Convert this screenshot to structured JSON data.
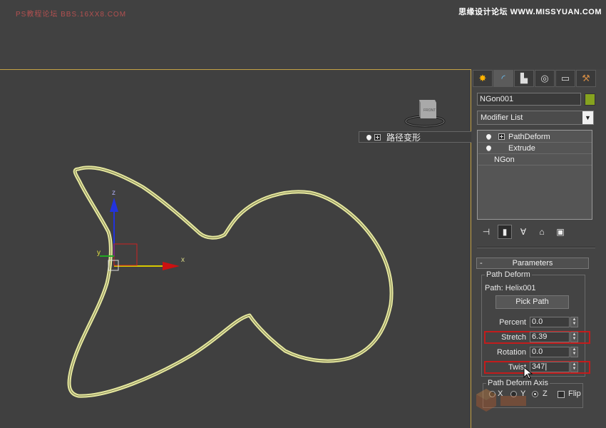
{
  "watermark": {
    "top_left": "PS教程论坛 BBS.16XX8.COM",
    "top_right": "思缘设计论坛 WWW.MISSYUAN.COM"
  },
  "viewport": {
    "viewcube_label": "FRONT",
    "axis_x": "x",
    "axis_y": "y",
    "axis_z": "z",
    "popup_label": "路径变形"
  },
  "command_panel": {
    "tabs": [
      "create-icon",
      "modify-icon",
      "hierarchy-icon",
      "motion-icon",
      "display-icon",
      "utilities-icon"
    ],
    "active_tab": "modify-icon",
    "object_name": "NGon001",
    "object_color": "#86a31f",
    "modifier_list_label": "Modifier List",
    "stack": [
      {
        "label": "PathDeform",
        "bulb": true,
        "expander": true
      },
      {
        "label": "Extrude",
        "bulb": true,
        "expander": false
      },
      {
        "label": "NGon",
        "bulb": false,
        "expander": false
      }
    ]
  },
  "parameters": {
    "rollout_toggle": "-",
    "rollout_title": "Parameters",
    "group_title": "Path Deform",
    "path_label": "Path: Helix001",
    "pick_path_label": "Pick Path",
    "fields": [
      {
        "label": "Percent",
        "value": "0.0",
        "highlighted": false
      },
      {
        "label": "Stretch",
        "value": "6.39",
        "highlighted": true
      },
      {
        "label": "Rotation",
        "value": "0.0",
        "highlighted": false
      },
      {
        "label": "Twist",
        "value": "347|",
        "highlighted": true
      }
    ],
    "axis_group_title": "Path Deform Axis",
    "axis_options": [
      {
        "label": "X",
        "selected": false
      },
      {
        "label": "Y",
        "selected": false
      },
      {
        "label": "Z",
        "selected": true
      }
    ],
    "flip_label": "Flip",
    "flip_checked": false
  }
}
